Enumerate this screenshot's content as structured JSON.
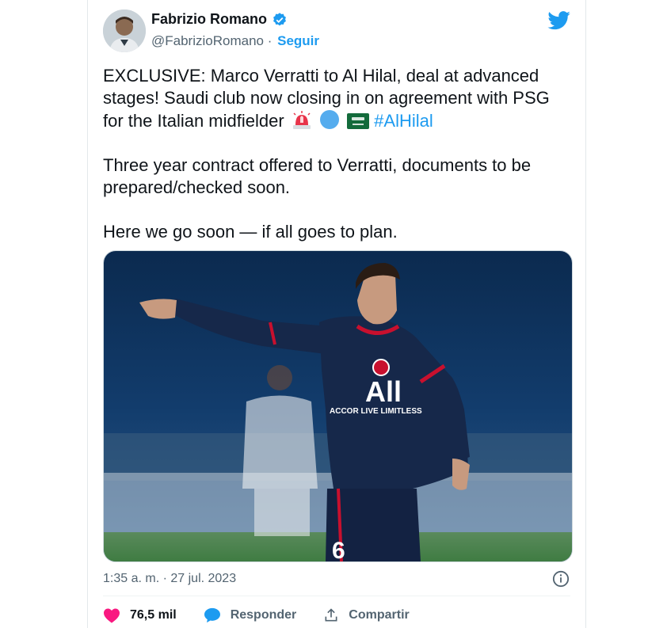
{
  "author": {
    "name": "Fabrizio Romano",
    "handle": "@FabrizioRomano",
    "follow_label": "Seguir"
  },
  "tweet": {
    "para1": "EXCLUSIVE: Marco Verratti to Al Hilal, deal at advanced stages! Saudi club now closing in on agreement with PSG for the Italian midfielder",
    "hashtag": "#AlHilal",
    "para2": "Three year contract offered to Verratti, documents to be prepared/checked soon.",
    "para3": "Here we go soon — if all goes to plan."
  },
  "media": {
    "shirt_sponsor": "All",
    "shirt_sponsor_sub": "ACCOR LIVE LIMITLESS",
    "shirt_number": "6"
  },
  "meta": {
    "timestamp": "1:35 a. m. · 27 jul. 2023"
  },
  "actions": {
    "likes": "76,5 mil",
    "reply_label": "Responder",
    "share_label": "Compartir"
  },
  "colors": {
    "accent": "#1d9bf0",
    "like": "#f91880",
    "text": "#0f1419",
    "muted": "#536471"
  },
  "icons": [
    "verified-badge-icon",
    "twitter-bird-icon",
    "info-icon",
    "heart-icon",
    "reply-bubble-icon",
    "share-icon"
  ]
}
